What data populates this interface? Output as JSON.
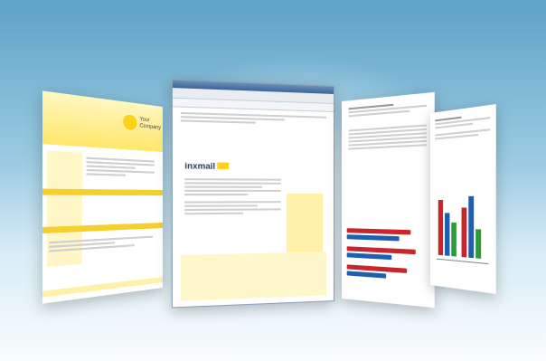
{
  "scene": {
    "colors": {
      "sky_top": "#5fa3c7",
      "accent_yellow": "#ffd21a",
      "bar_red": "#c8262c",
      "bar_blue": "#1f5fb0",
      "bar_green": "#2c9a3a"
    }
  },
  "newsletter": {
    "company_line1": "Your",
    "company_line2": "Company"
  },
  "app": {
    "logo": "inxmail"
  }
}
